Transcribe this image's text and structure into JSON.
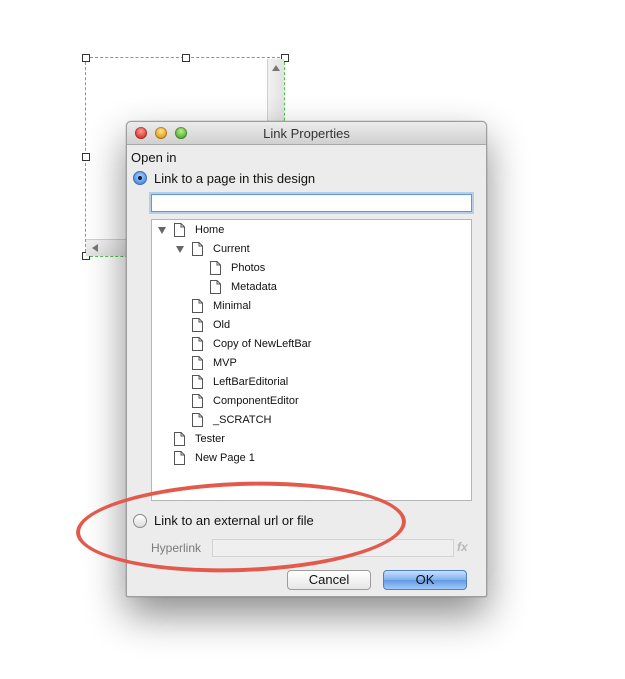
{
  "dialog": {
    "title": "Link Properties",
    "open_in_label": "Open in",
    "option_page_label": "Link to a page in this design",
    "search_value": "",
    "option_external_label": "Link to an external url or file",
    "hyperlink_label": "Hyperlink",
    "hyperlink_value": "",
    "fx_label": "fx",
    "cancel_label": "Cancel",
    "ok_label": "OK",
    "selected_option": "page"
  },
  "tree": {
    "items": [
      {
        "label": "Home",
        "expanded": true
      },
      {
        "label": "Current",
        "expanded": true
      },
      {
        "label": "Photos"
      },
      {
        "label": "Metadata"
      },
      {
        "label": "Minimal"
      },
      {
        "label": "Old"
      },
      {
        "label": "Copy of NewLeftBar"
      },
      {
        "label": "MVP"
      },
      {
        "label": "LeftBarEditorial"
      },
      {
        "label": "ComponentEditor"
      },
      {
        "label": "_SCRATCH"
      },
      {
        "label": "Tester"
      },
      {
        "label": "New Page 1"
      }
    ]
  },
  "icons": {
    "page": "page-icon",
    "disclosure": "disclosure-triangle-icon",
    "radio": "radio-button"
  },
  "colors": {
    "annotation": "#e35a4c",
    "selection_frame": "#4fbf4f",
    "ok_button": "#5e9be6"
  }
}
